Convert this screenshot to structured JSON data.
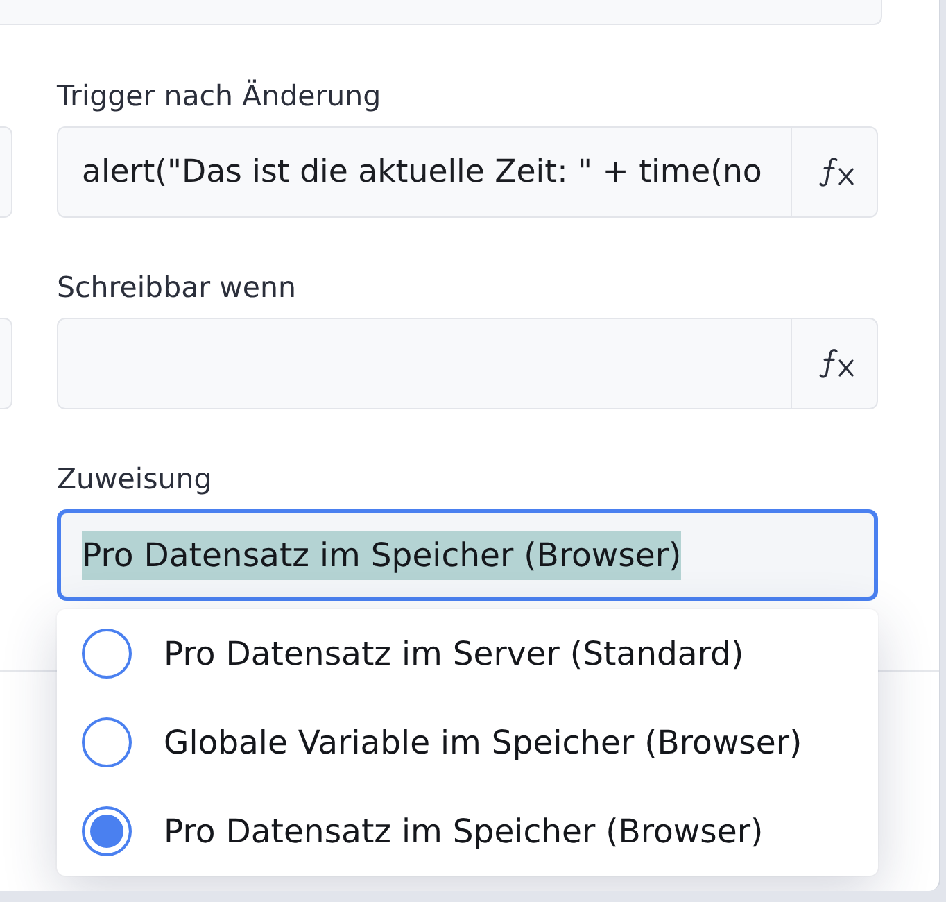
{
  "fields": [
    {
      "label": "Trigger nach Änderung",
      "kind": "formula",
      "value": "alert(\"Das ist die aktuelle Zeit: \" + time(no"
    },
    {
      "label": "Schreibbar wenn",
      "kind": "formula"
    }
  ],
  "assignment": {
    "label": "Zuweisung",
    "value": "Pro Datensatz im Speicher (Browser)",
    "focused": true,
    "value_highlighted": true,
    "open": true,
    "options": [
      {
        "label": "Pro Datensatz im Server (Standard)",
        "selected": false
      },
      {
        "label": "Globale Variable im Speicher (Browser)",
        "selected": false
      },
      {
        "label": "Pro Datensatz im Speicher (Browser)",
        "selected": true
      }
    ]
  }
}
